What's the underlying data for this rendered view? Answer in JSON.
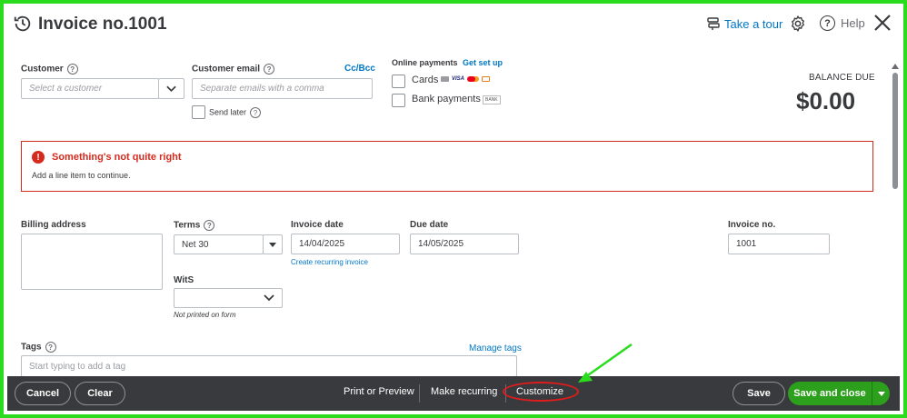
{
  "header": {
    "title": "Invoice no.1001",
    "take_tour": "Take a tour",
    "help": "Help"
  },
  "customer": {
    "label": "Customer",
    "placeholder": "Select a customer"
  },
  "email": {
    "label": "Customer email",
    "ccbcc": "Cc/Bcc",
    "placeholder": "Separate emails with a comma",
    "send_later": "Send later"
  },
  "payments": {
    "label": "Online payments",
    "setup": "Get set up",
    "cards": "Cards",
    "bank": "Bank payments",
    "card_brands": "VISA",
    "bank_badge": "BANK"
  },
  "balance": {
    "label": "BALANCE DUE",
    "amount": "$0.00"
  },
  "error": {
    "title": "Something's not quite right",
    "message": "Add a line item to continue."
  },
  "billing": {
    "label": "Billing address"
  },
  "terms": {
    "label": "Terms",
    "value": "Net 30"
  },
  "invoice_date": {
    "label": "Invoice date",
    "value": "14/04/2025",
    "recurring_link": "Create recurring invoice"
  },
  "due_date": {
    "label": "Due date",
    "value": "14/05/2025"
  },
  "invoice_no": {
    "label": "Invoice no.",
    "value": "1001"
  },
  "wits": {
    "label": "WitS",
    "note": "Not printed on form"
  },
  "tags": {
    "label": "Tags",
    "manage": "Manage tags",
    "placeholder": "Start typing to add a tag"
  },
  "footer": {
    "cancel": "Cancel",
    "clear": "Clear",
    "print_preview": "Print or Preview",
    "make_recurring": "Make recurring",
    "customize": "Customize",
    "save": "Save",
    "save_close": "Save and close"
  },
  "colors": {
    "frame": "#2bdc1e",
    "accent_green": "#2ca01c",
    "link_blue": "#0077c5",
    "error_red": "#d52b1e",
    "footer_bg": "#393a3d",
    "annotation_red": "#e21c1c"
  }
}
